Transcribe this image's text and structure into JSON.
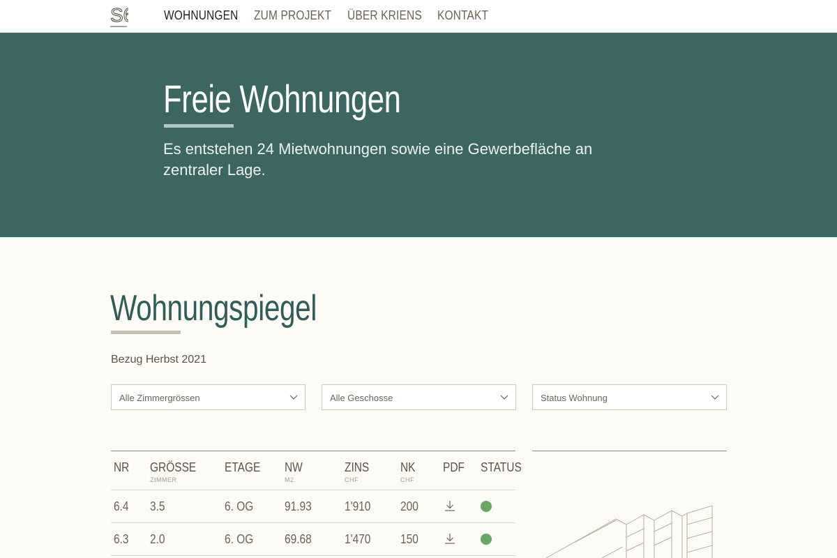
{
  "nav": {
    "logo": "S6",
    "items": [
      "WOHNUNGEN",
      "ZUM PROJEKT",
      "ÜBER KRIENS",
      "KONTAKT"
    ]
  },
  "hero": {
    "title": "Freie Wohnungen",
    "subtitle": "Es entstehen 24 Mietwohnungen sowie eine Gewerbefläche an zentraler Lage."
  },
  "section": {
    "title": "Wohnungspiegel",
    "subtitle": "Bezug Herbst 2021"
  },
  "filters": [
    {
      "label": "Alle Zimmergrössen",
      "icon": "chevron-down-icon"
    },
    {
      "label": "Alle Geschosse",
      "icon": "chevron-down-icon"
    },
    {
      "label": "Status Wohnung",
      "icon": "chevron-down-icon"
    }
  ],
  "table": {
    "headers": [
      {
        "label": "NR",
        "sub": ""
      },
      {
        "label": "GRÖSSE",
        "sub": "ZIMMER"
      },
      {
        "label": "ETAGE",
        "sub": ""
      },
      {
        "label": "NW",
        "sub": "M2"
      },
      {
        "label": "ZINS",
        "sub": "CHF"
      },
      {
        "label": "NK",
        "sub": "CHF"
      },
      {
        "label": "PDF",
        "sub": ""
      },
      {
        "label": "STATUS",
        "sub": ""
      }
    ],
    "rows": [
      {
        "nr": "6.4",
        "groesse": "3.5",
        "etage": "6. OG",
        "nw": "91.93",
        "zins": "1'910",
        "nk": "200",
        "pdf": "download-icon",
        "status": "available"
      },
      {
        "nr": "6.3",
        "groesse": "2.0",
        "etage": "6. OG",
        "nw": "69.68",
        "zins": "1'470",
        "nk": "150",
        "pdf": "download-icon",
        "status": "available"
      }
    ]
  },
  "colors": {
    "hero_bg": "#3c6662",
    "accent_green": "#2f5d59",
    "status_available": "#68a865",
    "page_bg": "#fcfbf6"
  }
}
